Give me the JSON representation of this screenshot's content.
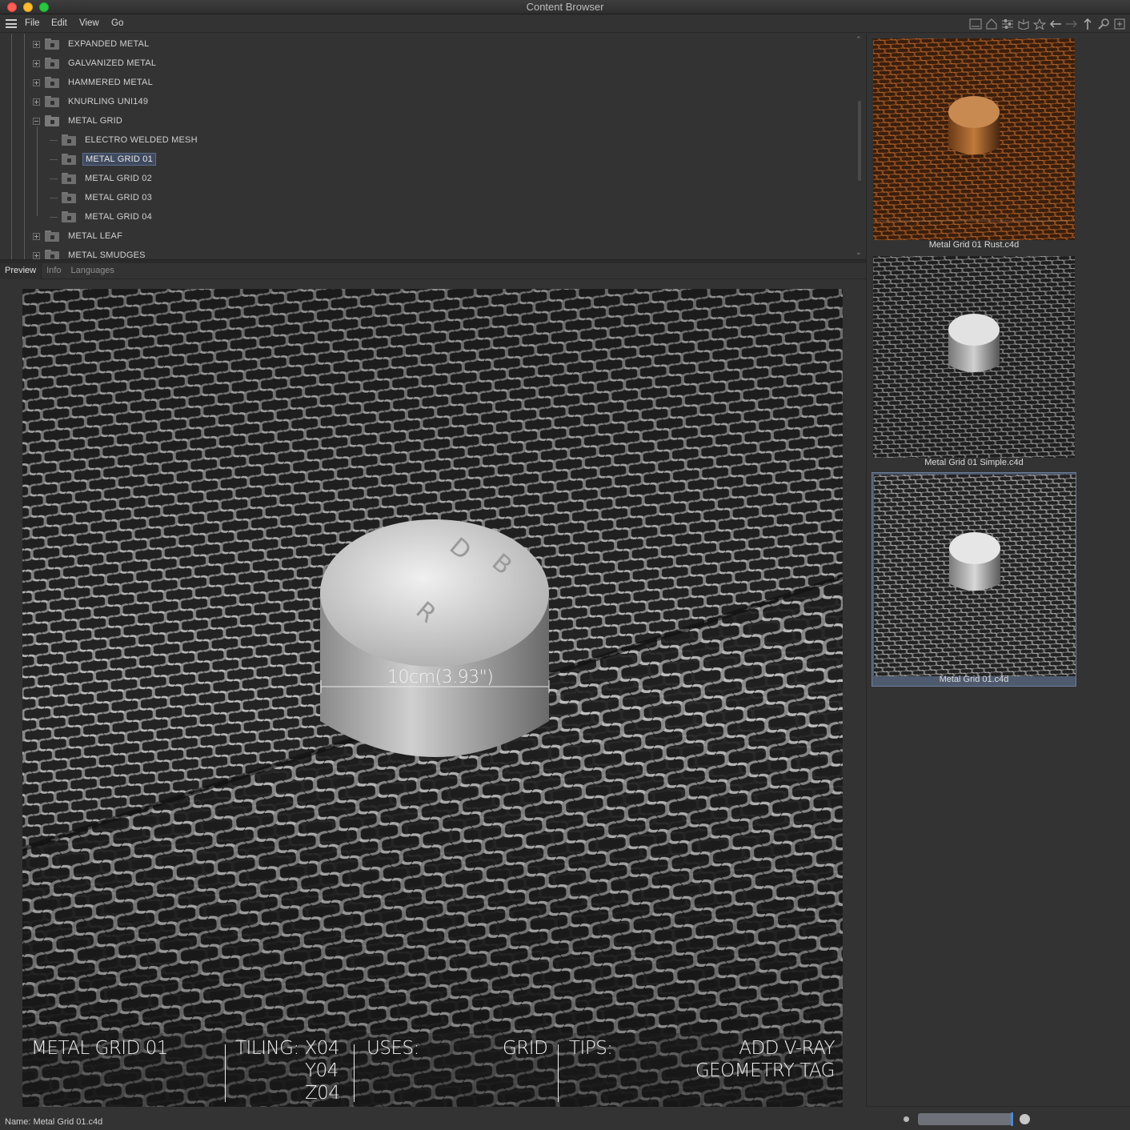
{
  "window": {
    "title": "Content Browser"
  },
  "menu": {
    "items": [
      "File",
      "Edit",
      "View",
      "Go"
    ]
  },
  "toolbar": {
    "icons": [
      "layout-icon",
      "home-icon",
      "settings-sliders-icon",
      "library-icon",
      "star-icon",
      "back-arrow-icon",
      "forward-arrow-icon",
      "up-arrow-icon",
      "search-icon",
      "new-window-icon"
    ]
  },
  "tree": {
    "items": [
      {
        "label": "EXPANDED METAL",
        "level": 1,
        "expander": "plus"
      },
      {
        "label": "GALVANIZED METAL",
        "level": 1,
        "expander": "plus"
      },
      {
        "label": "HAMMERED METAL",
        "level": 1,
        "expander": "plus"
      },
      {
        "label": "KNURLING UNI149",
        "level": 1,
        "expander": "plus"
      },
      {
        "label": "METAL GRID",
        "level": 1,
        "expander": "minus"
      },
      {
        "label": "ELECTRO WELDED MESH",
        "level": 2,
        "expander": "none"
      },
      {
        "label": "METAL GRID 01",
        "level": 2,
        "expander": "none",
        "selected": true
      },
      {
        "label": "METAL GRID 02",
        "level": 2,
        "expander": "none"
      },
      {
        "label": "METAL GRID 03",
        "level": 2,
        "expander": "none"
      },
      {
        "label": "METAL GRID 04",
        "level": 2,
        "expander": "none"
      },
      {
        "label": "METAL LEAF",
        "level": 1,
        "expander": "plus"
      },
      {
        "label": "METAL SMUDGES",
        "level": 1,
        "expander": "plus"
      }
    ]
  },
  "tabs": {
    "preview": "Preview",
    "info": "Info",
    "languages": "Languages"
  },
  "preview": {
    "measure": "10cm(3.93\")",
    "name": "METAL GRID 01",
    "tiling_label": "TILING: X04",
    "tiling_y": "Y04",
    "tiling_z": "Z04",
    "uses_label": "USES:",
    "uses_value": "GRID",
    "tips_label": "TIPS:",
    "tips_line1": "ADD V-RAY",
    "tips_line2": "GEOMETRY TAG"
  },
  "status": {
    "name_line": "Name:  Metal Grid 01.c4d"
  },
  "thumbnails": [
    {
      "label": "Metal Grid 01 Rust.c4d",
      "tone": "#8a4a22"
    },
    {
      "label": "Metal Grid 01 Simple.c4d",
      "tone": "#6a6a6a"
    },
    {
      "label": "Metal Grid 01.c4d",
      "tone": "#7a7a7a",
      "selected": true
    }
  ],
  "colors": {
    "selection": "#3f4a5f",
    "accent_blue": "#4a8bd8"
  }
}
